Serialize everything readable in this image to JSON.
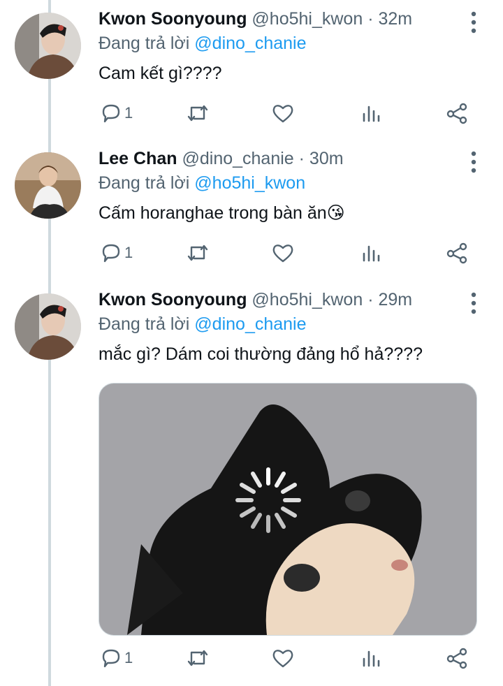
{
  "tweets": [
    {
      "name": "Kwon Soonyoung",
      "handle": "@ho5hi_kwon",
      "time": "· 32m",
      "replying_label": "Đang trả lời",
      "replying_to": "@dino_chanie",
      "text": "Cam kết gì????",
      "reply_count": "1",
      "avatar": "avatar-kwon-soonyoung"
    },
    {
      "name": "Lee Chan",
      "handle": "@dino_chanie",
      "time": "· 30m",
      "replying_label": "Đang trả lời",
      "replying_to": "@ho5hi_kwon",
      "text": "Cấm horanghae trong bàn ăn",
      "emoji": "😘",
      "reply_count": "1",
      "avatar": "avatar-lee-chan"
    },
    {
      "name": "Kwon Soonyoung",
      "handle": "@ho5hi_kwon",
      "time": "· 29m",
      "replying_label": "Đang trả lời",
      "replying_to": "@dino_chanie",
      "text": "mắc gì? Dám coi thường đảng hổ hả????",
      "reply_count": "1",
      "avatar": "avatar-kwon-soonyoung",
      "media": "cat-photo-with-loading-spinner"
    }
  ],
  "icons": [
    "reply-icon",
    "retweet-icon",
    "like-icon",
    "analytics-icon",
    "share-icon",
    "more-icon",
    "loading-spinner-icon"
  ],
  "colors": {
    "text": "#0f1419",
    "secondary": "#536471",
    "link": "#1d9bf0",
    "thread_line": "#cfd9de"
  }
}
